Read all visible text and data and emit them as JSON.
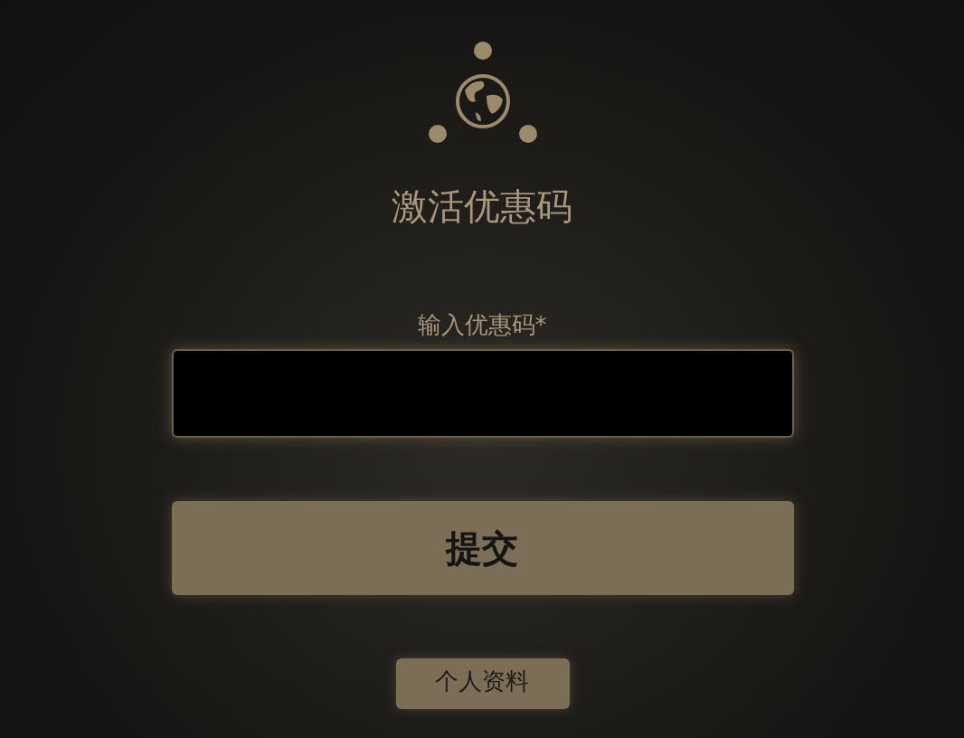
{
  "title": "激活优惠码",
  "code_field": {
    "label": "输入优惠码*"
  },
  "submit_button": "提交",
  "profile_button": "个人资料"
}
